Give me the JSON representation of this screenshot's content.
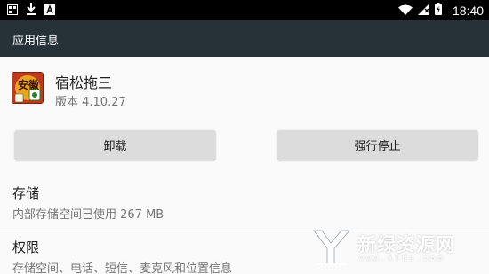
{
  "status_bar": {
    "time": "18:40",
    "left_icons": [
      "gallery-icon",
      "download-icon",
      "app-notification-icon"
    ],
    "right_icons": [
      "wifi-icon",
      "no-signal-icon",
      "battery-icon"
    ]
  },
  "app_bar": {
    "title": "应用信息",
    "background": "#263238"
  },
  "app": {
    "name": "宿松拖三",
    "version": "版本 4.10.27",
    "icon_text": "安徽"
  },
  "buttons": {
    "uninstall": "卸载",
    "force_stop": "强行停止"
  },
  "storage": {
    "title": "存储",
    "summary": "内部存储空间已使用 267 MB"
  },
  "permissions": {
    "title": "权限",
    "summary": "存储空间、电话、短信、麦克风和位置信息"
  },
  "watermark": {
    "text": "新绿资源网",
    "url": "www.xlhs.com"
  }
}
